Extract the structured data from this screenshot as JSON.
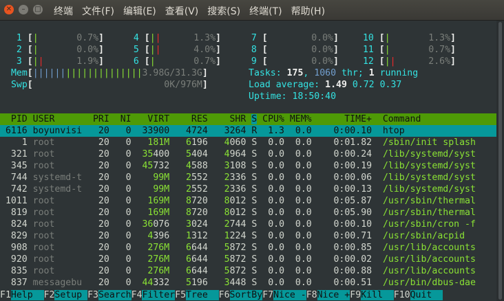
{
  "window": {
    "close_glyph": "✕",
    "min_glyph": "–",
    "max_glyph": "□",
    "menu": [
      "终端",
      "文件(F)",
      "编辑(E)",
      "查看(V)",
      "搜索(S)",
      "终端(T)",
      "帮助(H)"
    ]
  },
  "cpus": [
    {
      "num": "1",
      "bar": [
        "|"
      ],
      "pct": "0.7%"
    },
    {
      "num": "4",
      "bar": [
        "|",
        "|"
      ],
      "pct": "1.3%"
    },
    {
      "num": "7",
      "bar": [],
      "pct": "0.0%"
    },
    {
      "num": "10",
      "bar": [
        "|"
      ],
      "pct": "1.3%"
    },
    {
      "num": "2",
      "bar": [
        "|"
      ],
      "pct": "0.0%"
    },
    {
      "num": "5",
      "bar": [
        "|",
        "|"
      ],
      "pct": "4.0%"
    },
    {
      "num": "8",
      "bar": [],
      "pct": "0.0%"
    },
    {
      "num": "11",
      "bar": [
        "|"
      ],
      "pct": "0.7%"
    },
    {
      "num": "3",
      "bar": [
        "|",
        "|"
      ],
      "pct": "1.9%"
    },
    {
      "num": "6",
      "bar": [
        "|"
      ],
      "pct": "0.7%"
    },
    {
      "num": "9",
      "bar": [],
      "pct": "0.0%"
    },
    {
      "num": "12",
      "bar": [
        "|",
        "|"
      ],
      "pct": "2.6%"
    }
  ],
  "mem": {
    "label": "Mem",
    "bars": "||||||||||||||||||||",
    "value": "3.98G/31.3G"
  },
  "swp": {
    "label": "Swp",
    "value": "0K/976M"
  },
  "tasks": {
    "label": "Tasks:",
    "count": "175",
    "thr": "1060",
    "thr_label": "thr;",
    "running": "1",
    "running_label": "running"
  },
  "load": {
    "label": "Load average:",
    "v1": "1.49",
    "v5": "0.72",
    "v15": "0.37"
  },
  "uptime": {
    "label": "Uptime:",
    "value": "18:50:40"
  },
  "columns": [
    "PID",
    "USER",
    "PRI",
    "NI",
    "VIRT",
    "RES",
    "SHR",
    "S",
    "CPU%",
    "MEM%",
    "TIME+",
    "Command"
  ],
  "processes": [
    {
      "pid": "6116",
      "user": "boyunvisi",
      "pri": "20",
      "ni": "0",
      "virt": "33900",
      "res": "4724",
      "shr": "3264",
      "s": "R",
      "cpu": "1.3",
      "mem": "0.0",
      "time": "0:00.10",
      "cmd": "htop",
      "selected": true
    },
    {
      "pid": "1",
      "user": "root",
      "pri": "20",
      "ni": "0",
      "virt": "181M",
      "res": "6196",
      "shr": "4060",
      "s": "S",
      "cpu": "0.0",
      "mem": "0.0",
      "time": "0:01.82",
      "cmd": "/sbin/init splash"
    },
    {
      "pid": "321",
      "user": "root",
      "pri": "20",
      "ni": "0",
      "virt": "35400",
      "res": "5404",
      "shr": "4964",
      "s": "S",
      "cpu": "0.0",
      "mem": "0.0",
      "time": "0:00.24",
      "cmd": "/lib/systemd/syst"
    },
    {
      "pid": "345",
      "user": "root",
      "pri": "20",
      "ni": "0",
      "virt": "45732",
      "res": "4588",
      "shr": "3108",
      "s": "S",
      "cpu": "0.0",
      "mem": "0.0",
      "time": "0:00.19",
      "cmd": "/lib/systemd/syst"
    },
    {
      "pid": "744",
      "user": "systemd-t",
      "pri": "20",
      "ni": "0",
      "virt": "99M",
      "res": "2552",
      "shr": "2336",
      "s": "S",
      "cpu": "0.0",
      "mem": "0.0",
      "time": "0:00.06",
      "cmd": "/lib/systemd/syst"
    },
    {
      "pid": "742",
      "user": "systemd-t",
      "pri": "20",
      "ni": "0",
      "virt": "99M",
      "res": "2552",
      "shr": "2336",
      "s": "S",
      "cpu": "0.0",
      "mem": "0.0",
      "time": "0:00.13",
      "cmd": "/lib/systemd/syst"
    },
    {
      "pid": "1011",
      "user": "root",
      "pri": "20",
      "ni": "0",
      "virt": "169M",
      "res": "8720",
      "shr": "8012",
      "s": "S",
      "cpu": "0.0",
      "mem": "0.0",
      "time": "0:05.87",
      "cmd": "/usr/sbin/thermal"
    },
    {
      "pid": "819",
      "user": "root",
      "pri": "20",
      "ni": "0",
      "virt": "169M",
      "res": "8720",
      "shr": "8012",
      "s": "S",
      "cpu": "0.0",
      "mem": "0.0",
      "time": "0:05.90",
      "cmd": "/usr/sbin/thermal"
    },
    {
      "pid": "824",
      "user": "root",
      "pri": "20",
      "ni": "0",
      "virt": "36076",
      "res": "3024",
      "shr": "2744",
      "s": "S",
      "cpu": "0.0",
      "mem": "0.0",
      "time": "0:00.10",
      "cmd": "/usr/sbin/cron -f"
    },
    {
      "pid": "829",
      "user": "root",
      "pri": "20",
      "ni": "0",
      "virt": "4396",
      "res": "1312",
      "shr": "1224",
      "s": "S",
      "cpu": "0.0",
      "mem": "0.0",
      "time": "0:00.71",
      "cmd": "/usr/sbin/acpid"
    },
    {
      "pid": "908",
      "user": "root",
      "pri": "20",
      "ni": "0",
      "virt": "276M",
      "res": "6644",
      "shr": "5872",
      "s": "S",
      "cpu": "0.0",
      "mem": "0.0",
      "time": "0:00.85",
      "cmd": "/usr/lib/accounts"
    },
    {
      "pid": "920",
      "user": "root",
      "pri": "20",
      "ni": "0",
      "virt": "276M",
      "res": "6644",
      "shr": "5872",
      "s": "S",
      "cpu": "0.0",
      "mem": "0.0",
      "time": "0:00.02",
      "cmd": "/usr/lib/accounts"
    },
    {
      "pid": "835",
      "user": "root",
      "pri": "20",
      "ni": "0",
      "virt": "276M",
      "res": "6644",
      "shr": "5872",
      "s": "S",
      "cpu": "0.0",
      "mem": "0.0",
      "time": "0:00.88",
      "cmd": "/usr/lib/accounts"
    },
    {
      "pid": "837",
      "user": "messagebu",
      "pri": "20",
      "ni": "0",
      "virt": "44332",
      "res": "5196",
      "shr": "3448",
      "s": "S",
      "cpu": "0.0",
      "mem": "0.0",
      "time": "0:00.51",
      "cmd": "/usr/bin/dbus-dae"
    }
  ],
  "fkeys": [
    {
      "key": "F1",
      "label": "Help"
    },
    {
      "key": "F2",
      "label": "Setup"
    },
    {
      "key": "F3",
      "label": "Search"
    },
    {
      "key": "F4",
      "label": "Filter"
    },
    {
      "key": "F5",
      "label": "Tree"
    },
    {
      "key": "F6",
      "label": "SortBy"
    },
    {
      "key": "F7",
      "label": "Nice -"
    },
    {
      "key": "F8",
      "label": "Nice +"
    },
    {
      "key": "F9",
      "label": "Kill"
    },
    {
      "key": "F10",
      "label": "Quit"
    }
  ]
}
